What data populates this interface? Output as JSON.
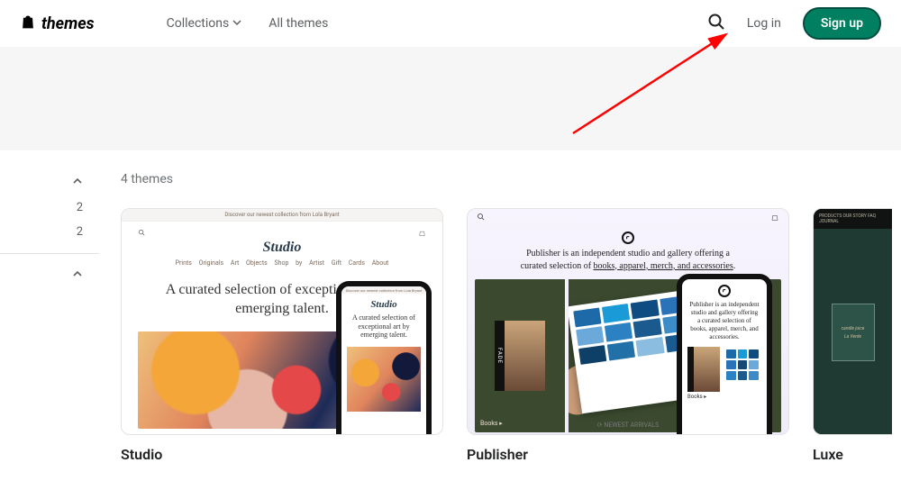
{
  "header": {
    "brand": "themes",
    "nav": {
      "collections": "Collections",
      "all": "All themes"
    },
    "login": "Log in",
    "signup": "Sign up"
  },
  "sidebar": {
    "num1": "2",
    "num2": "2"
  },
  "count_label": "4 themes",
  "cards": {
    "studio": {
      "title": "Studio",
      "topbar": "Discover our newest collection from Lola Bryant",
      "logo": "Studio",
      "menu": "Prints   Originals   Art Objects   Shop by Artist   Gift Cards   About",
      "hero": "A curated selection of exceptional art by emerging talent.",
      "phone_hero": "A curated selection of exceptional art by emerging talent."
    },
    "publisher": {
      "title": "Publisher",
      "hero_1": "Publisher is an independent studio and gallery offering a curated selection of ",
      "hero_links": "books, apparel, merch, and accessories",
      "hero_end": ".",
      "spine": "FADE",
      "left_label": "Books ▸",
      "footer": "⟳ NEWEST ARRIVALS",
      "phone_hero": "Publisher is an independent studio and gallery offering a curated selection of books, apparel, merch, and accessories.",
      "phone_label": "Books ▸"
    },
    "luxe": {
      "title": "Luxe",
      "nav": "PRODUCTS   OUR STORY   FAQ   JOURNAL",
      "book1": "candle juice",
      "book2": "La Verde"
    }
  },
  "swatches": [
    "#1e6aa8",
    "#1a9bd8",
    "#0f4c81",
    "#2a73b9",
    "#144a75",
    "#6aa9d9",
    "#2c81c2",
    "#1b5a8e",
    "#3c8cc7",
    "#145588",
    "#0e3f66",
    "#2270a8",
    "#8bbde0",
    "#195a90",
    "#0d4670"
  ]
}
